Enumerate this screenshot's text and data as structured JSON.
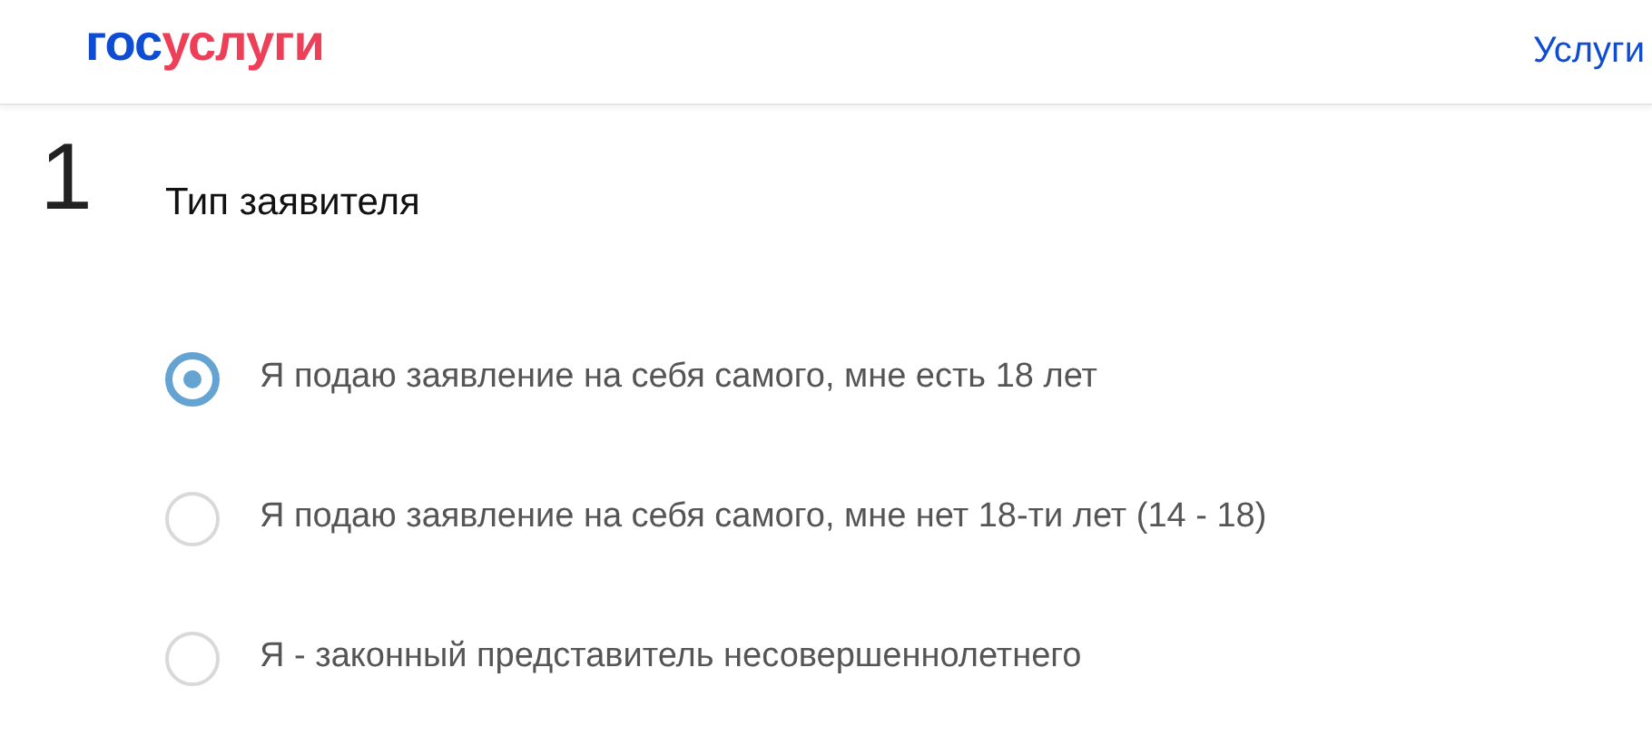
{
  "header": {
    "logo": [
      {
        "text": "гос",
        "color": "#0d4cd3"
      },
      {
        "text": "услуги",
        "color": "#ee3f58"
      }
    ],
    "nav_link": "Услуги"
  },
  "step": {
    "number": "1",
    "title": "Тип заявителя"
  },
  "options": [
    {
      "label": "Я подаю заявление на себя самого, мне есть 18 лет",
      "selected": true
    },
    {
      "label": "Я подаю заявление на себя самого, мне нет 18-ти лет (14 - 18)",
      "selected": false
    },
    {
      "label": "Я - законный представитель несовершеннолетнего",
      "selected": false
    }
  ]
}
